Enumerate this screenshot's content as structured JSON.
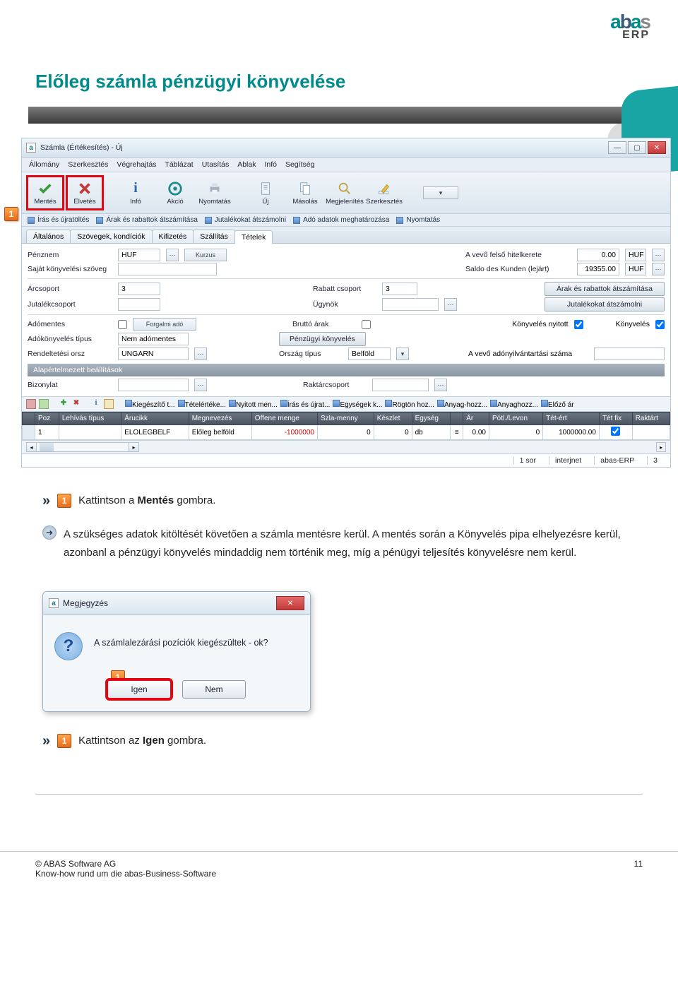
{
  "logo": {
    "brand_a": "a",
    "brand_b": "b",
    "brand_a2": "a",
    "brand_s": "s",
    "erp": "ERP"
  },
  "page_title": "Előleg számla pénzügyi könyvelése",
  "window_title": "Számla (Értékesítés) - Új",
  "menubar": [
    "Állomány",
    "Szerkesztés",
    "Végrehajtás",
    "Táblázat",
    "Utasítás",
    "Ablak",
    "Infó",
    "Segítség"
  ],
  "toolbar": {
    "mentes": "Mentés",
    "elvetes": "Elvetés",
    "info": "Infó",
    "akcio": "Akció",
    "nyomtatas": "Nyomtatás",
    "uj": "Új",
    "masolas": "Másolás",
    "megjelenites": "Megjelenítés",
    "szerkesztes": "Szerkesztés"
  },
  "linkbar": [
    "Írás és újratöltés",
    "Árak és rabattok átszámítása",
    "Jutalékokat átszámolni",
    "Adó adatok meghatározása",
    "Nyomtatás"
  ],
  "tabs": {
    "altalanos": "Általános",
    "szovegek": "Szövegek, kondíciók",
    "kifizetes": "Kifizetés",
    "szallitas": "Szállítás",
    "tetelek": "Tételek"
  },
  "form": {
    "penznem_lbl": "Pénznem",
    "penznem_val": "HUF",
    "kurzus_btn": "Kurzus",
    "sajat_lbl": "Saját könyvelési szöveg",
    "hitelkeret_lbl": "A vevő felső hitelkerete",
    "hitelkeret_val": "0.00",
    "hitelkeret_cur": "HUF",
    "saldo_lbl": "Saldo des Kunden (lejárt)",
    "saldo_val": "19355.00",
    "saldo_cur": "HUF",
    "arcsoport_lbl": "Árcsoport",
    "arcsoport_val": "3",
    "jutalekcsoport_lbl": "Jutalékcsoport",
    "rabatt_lbl": "Rabatt csoport",
    "rabatt_val": "3",
    "ugynok_lbl": "Ügynök",
    "arak_btn": "Árak és rabattok átszámítása",
    "jutalek_btn": "Jutalékokat átszámolni",
    "adomentes_lbl": "Adómentes",
    "forgalmi_btn": "Forgalmi adó",
    "adokonyv_lbl": "Adókönyvelés típus",
    "adokonyv_val": "Nem adómentes",
    "rendelt_lbl": "Rendeltetési orsz",
    "rendelt_val": "UNGARN",
    "brutto_lbl": "Bruttó árak",
    "penzugyi_btn": "Pénzügyi könyvelés",
    "orszagtipus_lbl": "Ország típus",
    "orszagtipus_val": "Belföld",
    "konyv_nyitott_lbl": "Könyvelés nyitott",
    "konyveles_lbl": "Könyvelés",
    "adonyilv_lbl": "A vevő adónyilvántartási száma",
    "alapbeall": "Alapértelmezett beállítások",
    "bizonylat_lbl": "Bizonylat",
    "raktarcsoport_lbl": "Raktárcsoport"
  },
  "gridbar": [
    "Kiegészítő t...",
    "Tételértéke...",
    "Nyitott men...",
    "Írás és újrat...",
    "Egységek k...",
    "Rögtön hoz...",
    "Anyag-hozz...",
    "Anyaghozz...",
    "Előző ár"
  ],
  "grid": {
    "headers": [
      "",
      "Poz",
      "Lehívás típus",
      "Árucikk",
      "Megnevezés",
      "Offene menge",
      "Szla-menny",
      "Készlet",
      "Egység",
      "",
      "Ár",
      "Pótl./Levon",
      "Tét-ért",
      "Tét fix",
      "Raktárt"
    ],
    "row": {
      "poz": "1",
      "arucikk": "ELOLEGBELF",
      "megnevezes": "Előleg belföld",
      "offene": "-1000000",
      "szlamenny": "0",
      "keszlet": "0",
      "egyseg": "db",
      "ar": "0.00",
      "potl": "0",
      "tetert": "1000000.00"
    }
  },
  "status": {
    "sor": "1 sor",
    "net": "interjnet",
    "app": "abas-ERP",
    "num": "3"
  },
  "steps": {
    "s1_text": "Kattintson a ",
    "s1_bold": "Mentés",
    "s1_suffix": " gombra.",
    "note1": "A szükséges adatok kitöltését követően a számla mentésre kerül. A mentés során a Könyvelés pipa elhelyezésre kerül, azonbanl a pénzügyi könyvelés mindaddig nem történik meg, míg a pénügyi teljesítés könyvelésre nem kerül.",
    "s2_text": "Kattintson az ",
    "s2_bold": "Igen",
    "s2_suffix": " gombra."
  },
  "dialog": {
    "title": "Megjegyzés",
    "msg": "A számlalezárási pozíciók kiegészültek - ok?",
    "igen": "Igen",
    "nem": "Nem",
    "badge": "1"
  },
  "footer": {
    "copyright": "© ABAS Software AG",
    "sub": "Know-how rund um die abas-Business-Software",
    "page": "11"
  }
}
